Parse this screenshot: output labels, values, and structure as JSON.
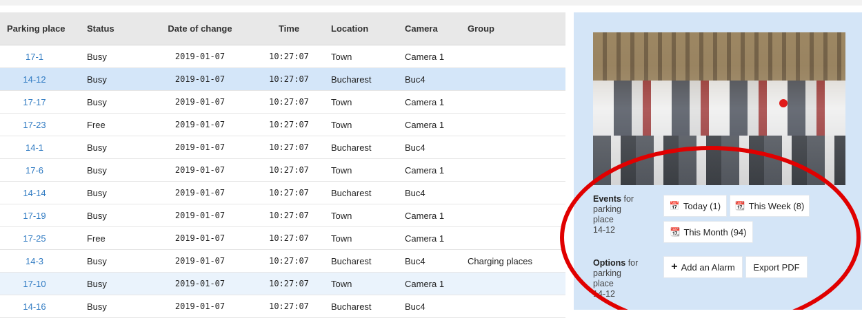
{
  "table": {
    "headers": [
      "Parking place",
      "Status",
      "Date of change",
      "Time",
      "Location",
      "Camera",
      "Group"
    ],
    "rows": [
      [
        "17-1",
        "Busy",
        "2019-01-07",
        "10:27:07",
        "Town",
        "Camera 1",
        ""
      ],
      [
        "14-12",
        "Busy",
        "2019-01-07",
        "10:27:07",
        "Bucharest",
        "Buc4",
        ""
      ],
      [
        "17-17",
        "Busy",
        "2019-01-07",
        "10:27:07",
        "Town",
        "Camera 1",
        ""
      ],
      [
        "17-23",
        "Free",
        "2019-01-07",
        "10:27:07",
        "Town",
        "Camera 1",
        ""
      ],
      [
        "14-1",
        "Busy",
        "2019-01-07",
        "10:27:07",
        "Bucharest",
        "Buc4",
        ""
      ],
      [
        "17-6",
        "Busy",
        "2019-01-07",
        "10:27:07",
        "Town",
        "Camera 1",
        ""
      ],
      [
        "14-14",
        "Busy",
        "2019-01-07",
        "10:27:07",
        "Bucharest",
        "Buc4",
        ""
      ],
      [
        "17-19",
        "Busy",
        "2019-01-07",
        "10:27:07",
        "Town",
        "Camera 1",
        ""
      ],
      [
        "17-25",
        "Free",
        "2019-01-07",
        "10:27:07",
        "Town",
        "Camera 1",
        ""
      ],
      [
        "14-3",
        "Busy",
        "2019-01-07",
        "10:27:07",
        "Bucharest",
        "Buc4",
        "Charging places"
      ],
      [
        "17-10",
        "Busy",
        "2019-01-07",
        "10:27:07",
        "Town",
        "Camera 1",
        ""
      ],
      [
        "14-16",
        "Busy",
        "2019-01-07",
        "10:27:07",
        "Bucharest",
        "Buc4",
        ""
      ]
    ],
    "selected_row": 1,
    "hover_row": 10
  },
  "panel": {
    "events": {
      "title": "Events",
      "suffix": " for",
      "line2": "parking",
      "line3": "place",
      "line4": "14-12"
    },
    "options": {
      "title": "Options",
      "suffix": " for",
      "line2": "parking",
      "line3": "place",
      "line4": "14-12"
    },
    "buttons": {
      "today": "Today (1)",
      "this_week": "This Week (8)",
      "this_month": "This Month (94)",
      "add_alarm": "Add an Alarm",
      "export_pdf": "Export PDF"
    },
    "icons": {
      "calendar_today": "calendar-icon",
      "calendar_week": "calendar-week-icon",
      "calendar_month": "calendar-month-icon",
      "plus": "plus-icon"
    }
  },
  "colors": {
    "link": "#2f7ac2",
    "selected_row": "#d4e6f9",
    "panel_bg": "#d4e5f7",
    "annotation": "#e00000"
  }
}
